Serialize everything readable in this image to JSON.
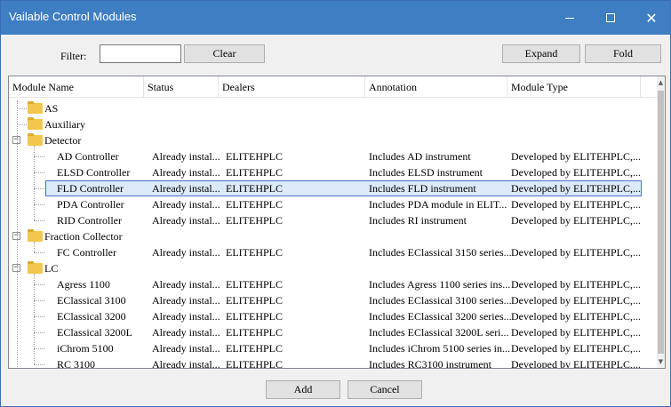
{
  "window": {
    "title": "Vailable Control Modules",
    "min_icon": "minimize-icon",
    "max_icon": "maximize-icon",
    "close_icon": "close-icon",
    "accent": "#3f7ec3"
  },
  "toolbar": {
    "filter_label": "Filter:",
    "filter_value": "",
    "clear_label": "Clear",
    "expand_label": "Expand",
    "fold_label": "Fold"
  },
  "columns": [
    "Module Name",
    "Status",
    "Dealers",
    "Annotation",
    "Module Type"
  ],
  "tree": [
    {
      "kind": "group",
      "label": "AS",
      "expanded": false,
      "toggle": ""
    },
    {
      "kind": "group",
      "label": "Auxiliary",
      "expanded": false,
      "toggle": ""
    },
    {
      "kind": "group",
      "label": "Detector",
      "expanded": true,
      "toggle": "−"
    },
    {
      "kind": "item",
      "name": "AD Controller",
      "status": "Already instal...",
      "dealer": "ELITEHPLC",
      "annotation": "Includes AD instrument",
      "type": "Developed by ELITEHPLC,..."
    },
    {
      "kind": "item",
      "name": "ELSD Controller",
      "status": "Already instal...",
      "dealer": "ELITEHPLC",
      "annotation": "Includes ELSD instrument",
      "type": "Developed by ELITEHPLC,..."
    },
    {
      "kind": "item",
      "name": "FLD Controller",
      "status": "Already instal...",
      "dealer": "ELITEHPLC",
      "annotation": "Includes FLD instrument",
      "type": "Developed by ELITEHPLC,...",
      "selected": true
    },
    {
      "kind": "item",
      "name": "PDA Controller",
      "status": "Already instal...",
      "dealer": "ELITEHPLC",
      "annotation": "Includes PDA module in ELIT...",
      "type": "Developed by ELITEHPLC,..."
    },
    {
      "kind": "item",
      "name": "RID Controller",
      "status": "Already instal...",
      "dealer": "ELITEHPLC",
      "annotation": "Includes RI instrument",
      "type": "Developed by ELITEHPLC,..."
    },
    {
      "kind": "group",
      "label": "Fraction Collector",
      "expanded": true,
      "toggle": "−"
    },
    {
      "kind": "item",
      "name": "FC Controller",
      "status": "Already instal...",
      "dealer": "ELITEHPLC",
      "annotation": "Includes EClassical 3150 series...",
      "type": "Developed by ELITEHPLC,..."
    },
    {
      "kind": "group",
      "label": "LC",
      "expanded": true,
      "toggle": "−"
    },
    {
      "kind": "item",
      "name": "Agress 1100",
      "status": "Already instal...",
      "dealer": "ELITEHPLC",
      "annotation": "Includes Agress 1100 series ins...",
      "type": "Developed by ELITEHPLC,..."
    },
    {
      "kind": "item",
      "name": "EClassical 3100",
      "status": "Already instal...",
      "dealer": "ELITEHPLC",
      "annotation": "Includes EClassical 3100 series...",
      "type": "Developed by ELITEHPLC,..."
    },
    {
      "kind": "item",
      "name": "EClassical 3200",
      "status": "Already instal...",
      "dealer": "ELITEHPLC",
      "annotation": "Includes EClassical 3200 series...",
      "type": "Developed by ELITEHPLC,..."
    },
    {
      "kind": "item",
      "name": "EClassical 3200L",
      "status": "Already instal...",
      "dealer": "ELITEHPLC",
      "annotation": "Includes EClassical 3200L seri...",
      "type": "Developed by ELITEHPLC,..."
    },
    {
      "kind": "item",
      "name": "iChrom 5100",
      "status": "Already instal...",
      "dealer": "ELITEHPLC",
      "annotation": "Includes iChrom 5100 series in...",
      "type": "Developed by ELITEHPLC,..."
    },
    {
      "kind": "item",
      "name": "RC 3100",
      "status": "Already instal...",
      "dealer": "ELITEHPLC",
      "annotation": "Includes RC3100 instrument",
      "type": "Developed by ELITEHPLC,..."
    }
  ],
  "footer": {
    "add_label": "Add",
    "cancel_label": "Cancel"
  }
}
